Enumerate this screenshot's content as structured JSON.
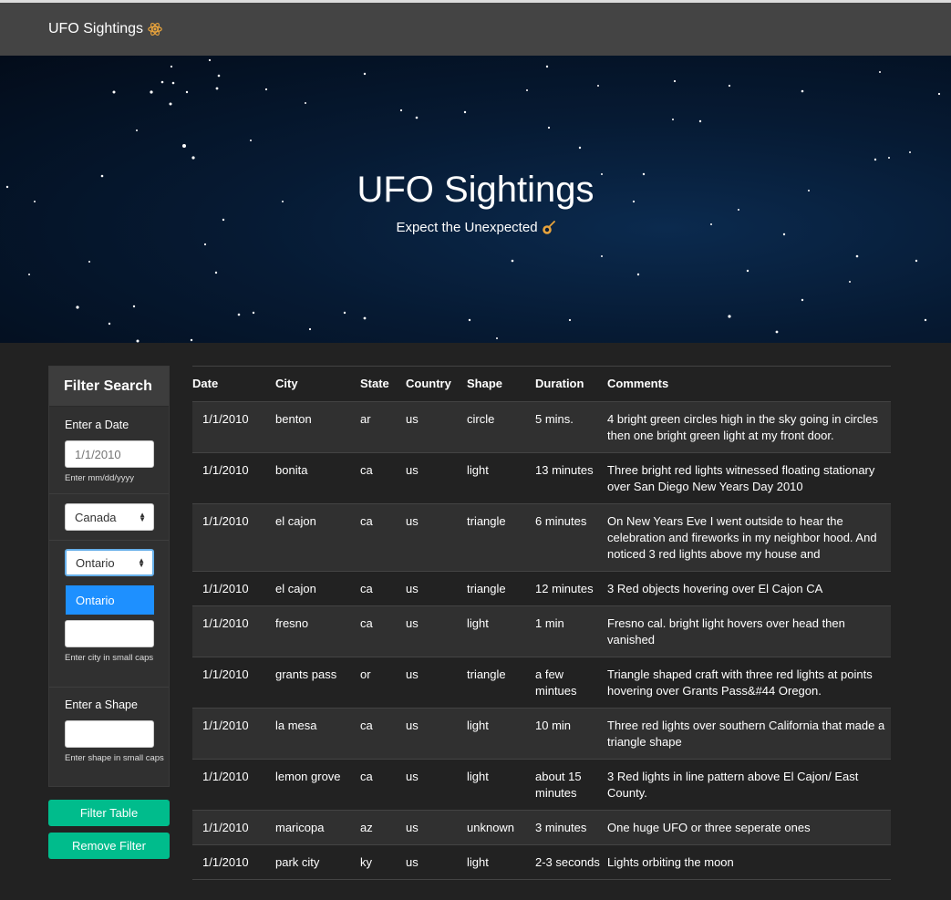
{
  "navbar": {
    "brand": "UFO Sightings",
    "brand_icon": "atom-icon"
  },
  "hero": {
    "title": "UFO Sightings",
    "subtitle": "Expect the Unexpected",
    "subtitle_icon": "comet-icon"
  },
  "filters": {
    "title": "Filter Search",
    "date_label": "Enter a Date",
    "date_placeholder": "1/1/2010",
    "date_help": "Enter mm/dd/yyyy",
    "country_value": "Canada",
    "state_value": "Ontario",
    "state_dropdown_option": "Ontario",
    "city_placeholder": "",
    "city_help": "Enter city in small caps",
    "shape_label": "Enter a Shape",
    "shape_placeholder": "",
    "shape_help": "Enter shape in small caps"
  },
  "buttons": {
    "filter": "Filter Table",
    "remove": "Remove Filter"
  },
  "table": {
    "headers": [
      "Date",
      "City",
      "State",
      "Country",
      "Shape",
      "Duration",
      "Comments"
    ],
    "rows": [
      [
        "1/1/2010",
        "benton",
        "ar",
        "us",
        "circle",
        "5 mins.",
        "4 bright green circles high in the sky going in circles then one bright green light at my front door."
      ],
      [
        "1/1/2010",
        "bonita",
        "ca",
        "us",
        "light",
        "13 minutes",
        "Three bright red lights witnessed floating stationary over San Diego New Years Day 2010"
      ],
      [
        "1/1/2010",
        "el cajon",
        "ca",
        "us",
        "triangle",
        "6 minutes",
        "On New Years Eve I went outside to hear the celebration and fireworks in my neighbor hood. And noticed 3 red lights above my house and"
      ],
      [
        "1/1/2010",
        "el cajon",
        "ca",
        "us",
        "triangle",
        "12 minutes",
        "3 Red objects hovering over El Cajon CA"
      ],
      [
        "1/1/2010",
        "fresno",
        "ca",
        "us",
        "light",
        "1 min",
        "Fresno cal. bright light hovers over head then vanished"
      ],
      [
        "1/1/2010",
        "grants pass",
        "or",
        "us",
        "triangle",
        "a few mintues",
        "Triangle shaped craft with three red lights at points hovering over Grants Pass&#44 Oregon."
      ],
      [
        "1/1/2010",
        "la mesa",
        "ca",
        "us",
        "light",
        "10 min",
        "Three red lights over southern California that made a triangle shape"
      ],
      [
        "1/1/2010",
        "lemon grove",
        "ca",
        "us",
        "light",
        "about 15 minutes",
        "3 Red lights in line pattern above El Cajon/ East County."
      ],
      [
        "1/1/2010",
        "maricopa",
        "az",
        "us",
        "unknown",
        "3 minutes",
        "One huge UFO or three seperate ones"
      ],
      [
        "1/1/2010",
        "park city",
        "ky",
        "us",
        "light",
        "2-3 seconds",
        "Lights orbiting the moon"
      ]
    ]
  }
}
